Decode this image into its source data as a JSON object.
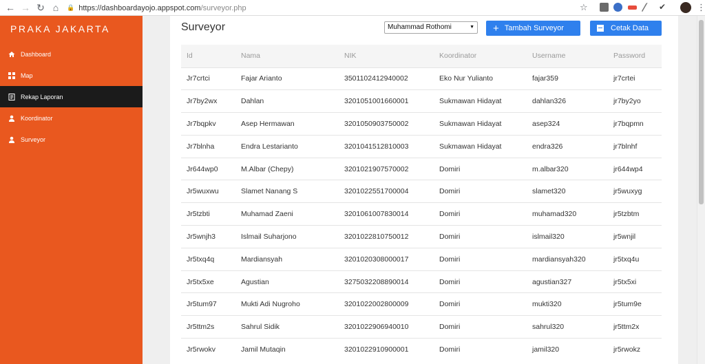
{
  "browser": {
    "url_host": "https://dashboardayojo.appspot.com",
    "url_path": "/surveyor.php"
  },
  "sidebar": {
    "brand": "PRAKA JAKARTA",
    "items": [
      {
        "label": "Dashboard",
        "icon": "home-icon"
      },
      {
        "label": "Map",
        "icon": "grid-icon"
      },
      {
        "label": "Rekap Laporan",
        "icon": "report-icon"
      },
      {
        "label": "Koordinator",
        "icon": "user-icon"
      },
      {
        "label": "Surveyor",
        "icon": "user-icon"
      }
    ],
    "active": "Rekap Laporan"
  },
  "main": {
    "title": "Surveyor",
    "selected_koordinator": "Muhammad Rothomi",
    "add_button": "Tambah Surveyor",
    "print_button": "Cetak Data",
    "columns": [
      "Id",
      "Nama",
      "NIK",
      "Koordinator",
      "Username",
      "Password"
    ],
    "rows": [
      [
        "Jr7crtci",
        "Fajar Arianto",
        "3501102412940002",
        "Eko Nur Yulianto",
        "fajar359",
        "jr7crtei"
      ],
      [
        "Jr7by2wx",
        "Dahlan",
        "3201051001660001",
        "Sukmawan Hidayat",
        "dahlan326",
        "jr7by2yo"
      ],
      [
        "Jr7bqpkv",
        "Asep Hermawan",
        "3201050903750002",
        "Sukmawan Hidayat",
        "asep324",
        "jr7bqpmn"
      ],
      [
        "Jr7blnha",
        "Endra Lestarianto",
        "3201041512810003",
        "Sukmawan Hidayat",
        "endra326",
        "jr7blnhf"
      ],
      [
        "Jr644wp0",
        "M.Albar (Chepy)",
        "3201021907570002",
        "Domiri",
        "m.albar320",
        "jr644wp4"
      ],
      [
        "Jr5wuxwu",
        "Slamet Nanang S",
        "3201022551700004",
        "Domiri",
        "slamet320",
        "jr5wuxyg"
      ],
      [
        "Jr5tzbti",
        "Muhamad Zaeni",
        "3201061007830014",
        "Domiri",
        "muhamad320",
        "jr5tzbtm"
      ],
      [
        "Jr5wnjh3",
        "Islmail Suharjono",
        "3201022810750012",
        "Domiri",
        "islmail320",
        "jr5wnjil"
      ],
      [
        "Jr5txq4q",
        "Mardiansyah",
        "3201020308000017",
        "Domiri",
        "mardiansyah320",
        "jr5txq4u"
      ],
      [
        "Jr5tx5xe",
        "Agustian",
        "3275032208890014",
        "Domiri",
        "agustian327",
        "jr5tx5xi"
      ],
      [
        "Jr5tum97",
        "Mukti Adi Nugroho",
        "3201022002800009",
        "Domiri",
        "mukti320",
        "jr5tum9e"
      ],
      [
        "Jr5ttm2s",
        "Sahrul Sidik",
        "3201022906940010",
        "Domiri",
        "sahrul320",
        "jr5ttm2x"
      ],
      [
        "Jr5rwokv",
        "Jamil Mutaqin",
        "3201022910900001",
        "Domiri",
        "jamil320",
        "jr5rwokz"
      ]
    ]
  },
  "colors": {
    "sidebar": "#e9581f",
    "active_item": "#1b1b1b",
    "button": "#2f80ed"
  }
}
